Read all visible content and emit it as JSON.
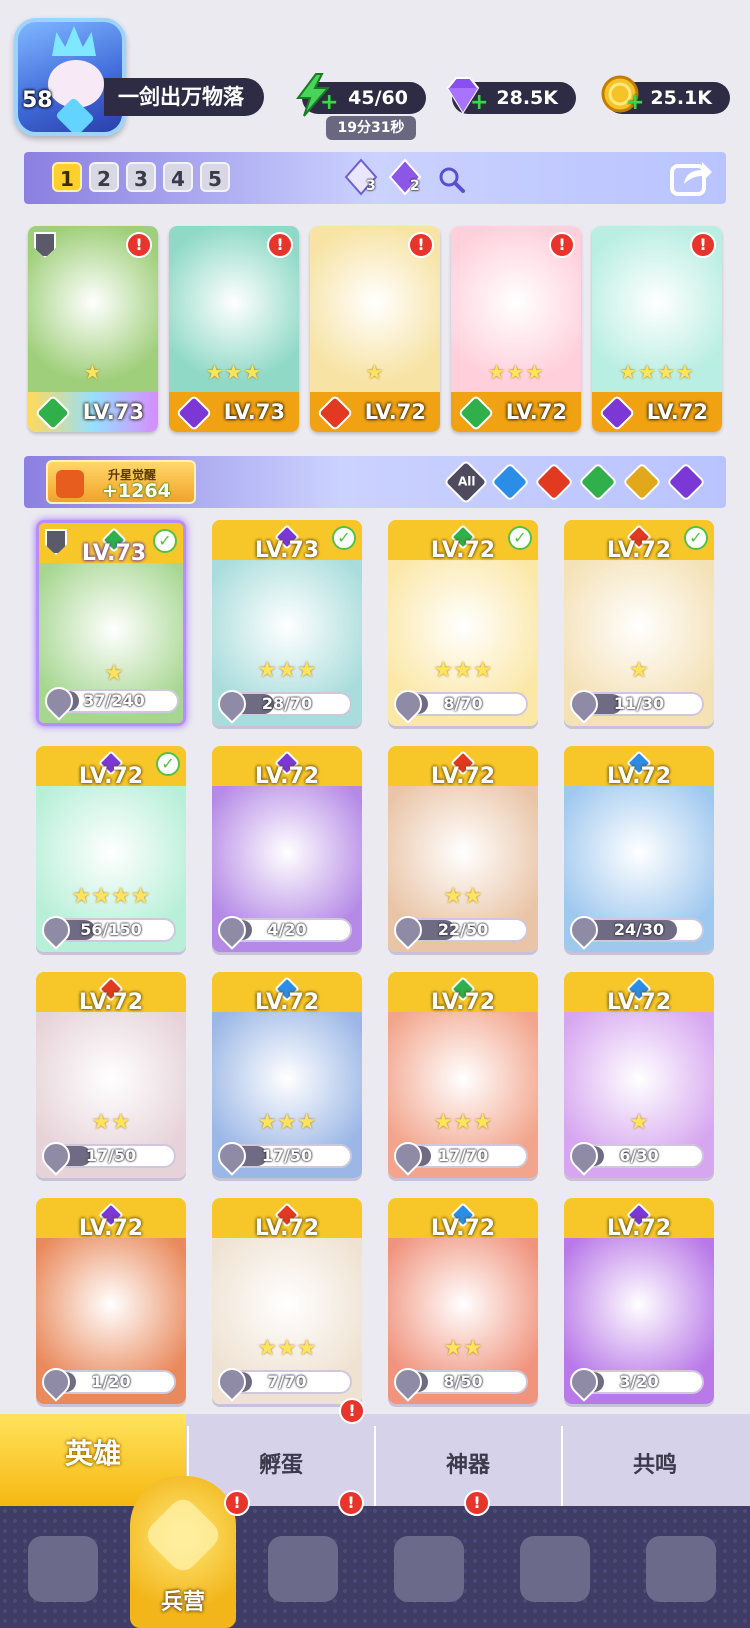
{
  "player": {
    "level": "58",
    "name": "一剑出万物落"
  },
  "resources": {
    "energy": {
      "value": "45/60",
      "timer": "19分31秒",
      "icon": "lightning-icon"
    },
    "gems": {
      "value": "28.5K",
      "icon": "gem-icon"
    },
    "coins": {
      "value": "25.1K",
      "icon": "coin-icon"
    }
  },
  "lineup_tabs": [
    "1",
    "2",
    "3",
    "4",
    "5"
  ],
  "lineup_active_tab": "1",
  "crystals": [
    {
      "icon": "white-crystal-icon",
      "count": "3"
    },
    {
      "icon": "purple-crystal-icon",
      "count": "2"
    }
  ],
  "lineup": [
    {
      "level": "LV.73",
      "element": "nature",
      "stars": "★",
      "alert": "!",
      "bar": "rainbow",
      "art": "#9fcf7a"
    },
    {
      "level": "LV.73",
      "element": "dark",
      "stars": "★★★",
      "alert": "!",
      "bar": "orange",
      "art": "#8fd9c6"
    },
    {
      "level": "LV.72",
      "element": "fire",
      "stars": "★",
      "alert": "!",
      "bar": "orange",
      "art": "#f7e3a4"
    },
    {
      "level": "LV.72",
      "element": "nature",
      "stars": "★★★",
      "alert": "!",
      "bar": "orange",
      "art": "#ffd0dc"
    },
    {
      "level": "LV.72",
      "element": "dark",
      "stars": "★★★★",
      "alert": "!",
      "bar": "orange",
      "art": "#b9eee2"
    }
  ],
  "awaken": {
    "label": "升星觉醒",
    "value": "+1264"
  },
  "filter": {
    "all_label": "All",
    "elements": [
      "water",
      "fire",
      "nature",
      "light",
      "dark"
    ]
  },
  "heroes": [
    {
      "level": "LV.73",
      "element": "nature",
      "progress": "37/240",
      "fraction": 0.154,
      "stars": "★",
      "check": true,
      "shield": true,
      "selected": true,
      "art": "#a6d690"
    },
    {
      "level": "LV.73",
      "element": "dark",
      "progress": "28/70",
      "fraction": 0.4,
      "stars": "★★★",
      "check": true,
      "art": "#a9dcdc"
    },
    {
      "level": "LV.72",
      "element": "nature",
      "progress": "8/70",
      "fraction": 0.114,
      "stars": "★★★",
      "check": true,
      "art": "#fbe7a6"
    },
    {
      "level": "LV.72",
      "element": "fire",
      "progress": "11/30",
      "fraction": 0.367,
      "stars": "★",
      "check": true,
      "art": "#f4e1b6"
    },
    {
      "level": "LV.72",
      "element": "dark",
      "progress": "56/150",
      "fraction": 0.373,
      "stars": "★★★★",
      "check": true,
      "art": "#b7efd8"
    },
    {
      "level": "LV.72",
      "element": "dark",
      "progress": "4/20",
      "fraction": 0.2,
      "stars": "",
      "art": "#b58ae6"
    },
    {
      "level": "LV.72",
      "element": "fire",
      "progress": "22/50",
      "fraction": 0.44,
      "stars": "★★",
      "art": "#e9c4a6"
    },
    {
      "level": "LV.72",
      "element": "water",
      "progress": "24/30",
      "fraction": 0.8,
      "stars": "",
      "art": "#9fc8ef"
    },
    {
      "level": "LV.72",
      "element": "fire",
      "progress": "17/50",
      "fraction": 0.34,
      "stars": "★★",
      "art": "#e6d3d9"
    },
    {
      "level": "LV.72",
      "element": "water",
      "progress": "17/50",
      "fraction": 0.34,
      "stars": "★★★",
      "art": "#9bb7e6"
    },
    {
      "level": "LV.72",
      "element": "nature",
      "progress": "17/70",
      "fraction": 0.243,
      "stars": "★★★",
      "art": "#f2a58c"
    },
    {
      "level": "LV.72",
      "element": "water",
      "progress": "6/30",
      "fraction": 0.2,
      "stars": "★",
      "art": "#d6a6f0"
    },
    {
      "level": "LV.72",
      "element": "dark",
      "progress": "1/20",
      "fraction": 0.05,
      "stars": "",
      "art": "#e98a5c"
    },
    {
      "level": "LV.72",
      "element": "fire",
      "progress": "7/70",
      "fraction": 0.1,
      "stars": "★★★",
      "art": "#efe2d2"
    },
    {
      "level": "LV.72",
      "element": "water",
      "progress": "8/50",
      "fraction": 0.16,
      "stars": "★★",
      "art": "#f0947e"
    },
    {
      "level": "LV.72",
      "element": "dark",
      "progress": "3/20",
      "fraction": 0.15,
      "stars": "",
      "art": "#b979e8"
    }
  ],
  "subtabs": [
    {
      "label": "英雄",
      "active": true
    },
    {
      "label": "孵蛋",
      "alert": "!"
    },
    {
      "label": "神器"
    },
    {
      "label": "共鸣"
    }
  ],
  "nav": [
    {
      "icon": "cards-icon"
    },
    {
      "icon": "barracks-icon",
      "label": "兵营",
      "active": true
    },
    {
      "icon": "map-icon",
      "alert": "!"
    },
    {
      "icon": "castle-icon",
      "alert": "!"
    },
    {
      "icon": "mushroom-icon"
    },
    {
      "icon": "guild-banner-icon"
    }
  ],
  "colors": {
    "nature": "#2fb04a",
    "dark": "#7b38d6",
    "fire": "#e23a21",
    "water": "#2b8ee6",
    "light": "#e0a81a",
    "accent_yellow": "#f7c72a"
  }
}
